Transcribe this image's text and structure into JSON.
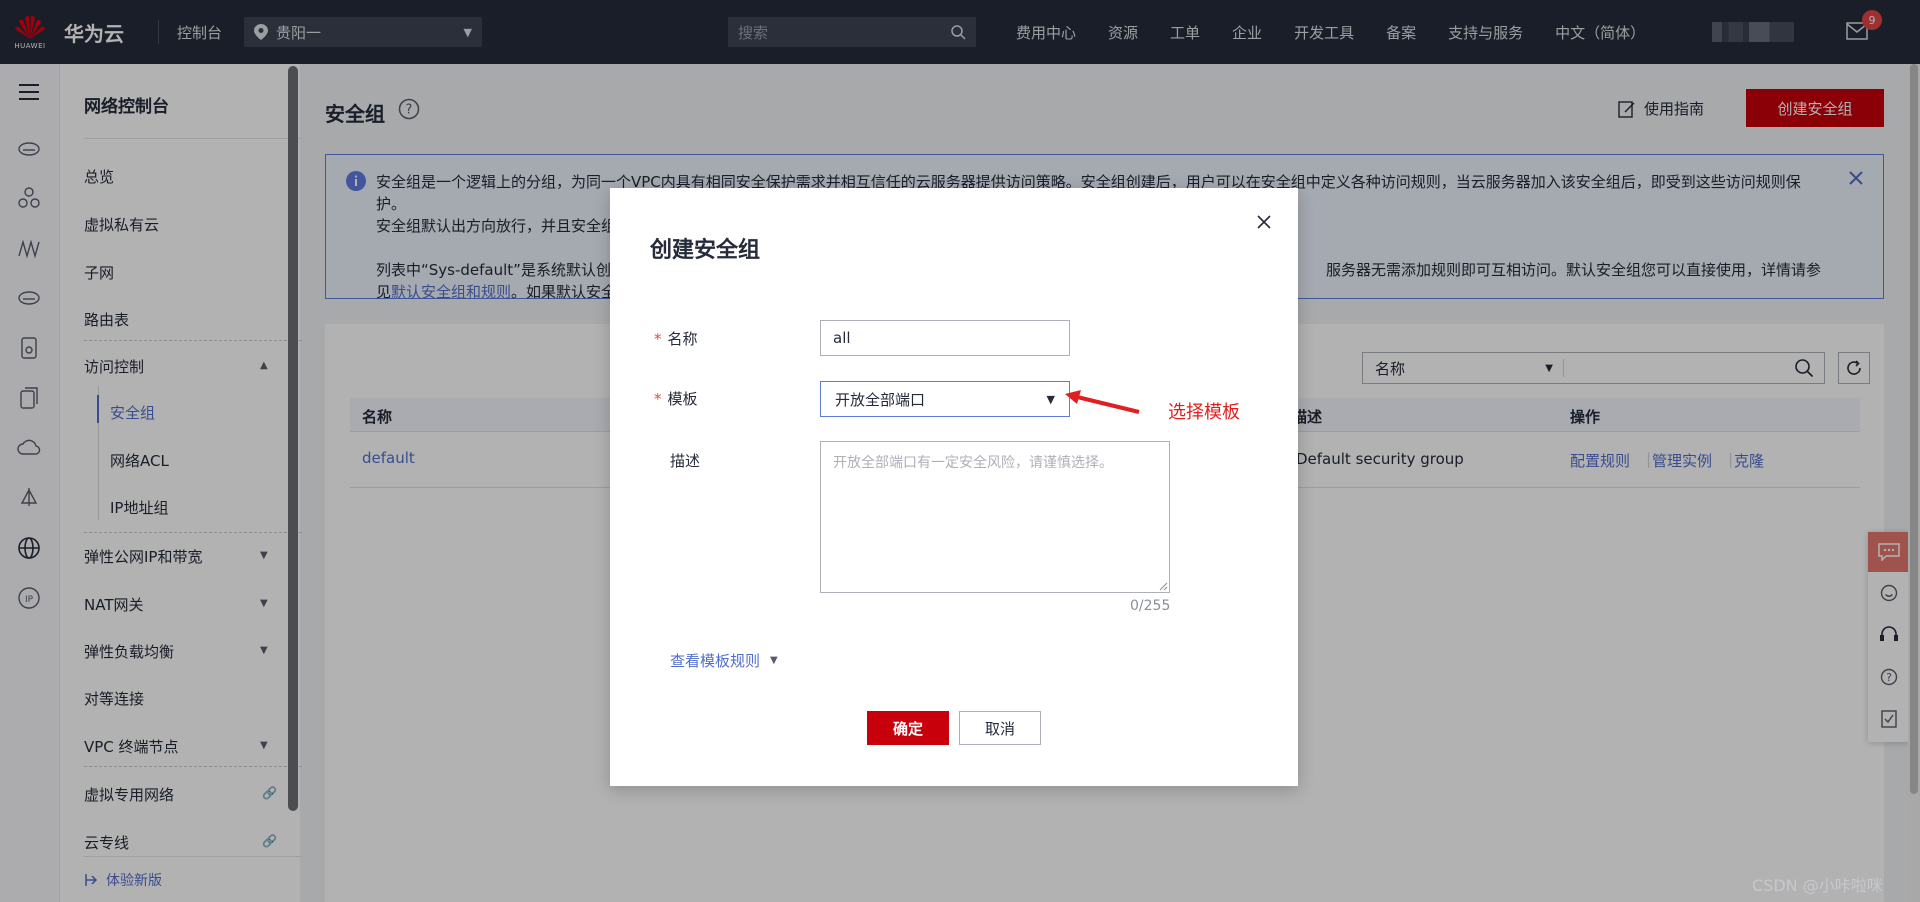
{
  "topbar": {
    "logo_word": "HUAWEI",
    "brand": "华为云",
    "console": "控制台",
    "region": "贵阳一",
    "search_placeholder": "搜索",
    "nav": [
      "费用中心",
      "资源",
      "工单",
      "企业",
      "开发工具",
      "备案",
      "支持与服务",
      "中文（简体）"
    ],
    "mail_badge": "9"
  },
  "sidebar": {
    "title": "网络控制台",
    "items": {
      "overview": "总览",
      "vpc": "虚拟私有云",
      "subnet": "子网",
      "route_table": "路由表",
      "access_control": "访问控制",
      "security_group": "安全组",
      "network_acl": "网络ACL",
      "ip_group": "IP地址组",
      "eip": "弹性公网IP和带宽",
      "nat": "NAT网关",
      "elb": "弹性负载均衡",
      "peering": "对等连接",
      "vpcep": "VPC 终端节点",
      "vpn": "虚拟专用网络",
      "dc": "云专线",
      "try_new": "体验新版"
    }
  },
  "main": {
    "title": "安全组",
    "guide": "使用指南",
    "create_button": "创建安全组",
    "info": {
      "line1": "安全组是一个逻辑上的分组，为同一个VPC内具有相同安全保护需求并相互信任的云服务器提供访问策略。安全组创建后，用户可以在安全组中定义各种访问规则，当云服务器加入该安全组后，即受到这些访问规则保护。",
      "line2": "安全组默认出方向放行，并且安全组",
      "line3a": "列表中“Sys-default”是系统默认创建",
      "line3b": "服务器无需添加规则即可互相访问。默认安全组您可以直接使用，详情请参见",
      "line3_link": "默认安全组和规则",
      "line3c": "。如果默认安全组不"
    },
    "filter": {
      "field": "名称"
    },
    "table": {
      "headers": {
        "name": "名称",
        "description": "描述",
        "actions": "操作"
      },
      "rows": [
        {
          "name": "default",
          "description": "Default security group",
          "actions": [
            "配置规则",
            "管理实例",
            "克隆"
          ]
        }
      ]
    }
  },
  "dialog": {
    "title": "创建安全组",
    "name_label": "名称",
    "name_value": "all",
    "template_label": "模板",
    "template_value": "开放全部端口",
    "desc_label": "描述",
    "desc_placeholder": "开放全部端口有一定安全风险，请谨慎选择。",
    "desc_count": "0/255",
    "rules_link": "查看模板规则",
    "ok": "确定",
    "cancel": "取消",
    "required_mark": "*"
  },
  "annotation": {
    "text": "选择模板",
    "color": "#e02020"
  },
  "watermark": "CSDN @小咔啦咪",
  "colors": {
    "brand_red": "#c7000b",
    "link_blue": "#526ecc",
    "topbar": "#252b3a"
  }
}
